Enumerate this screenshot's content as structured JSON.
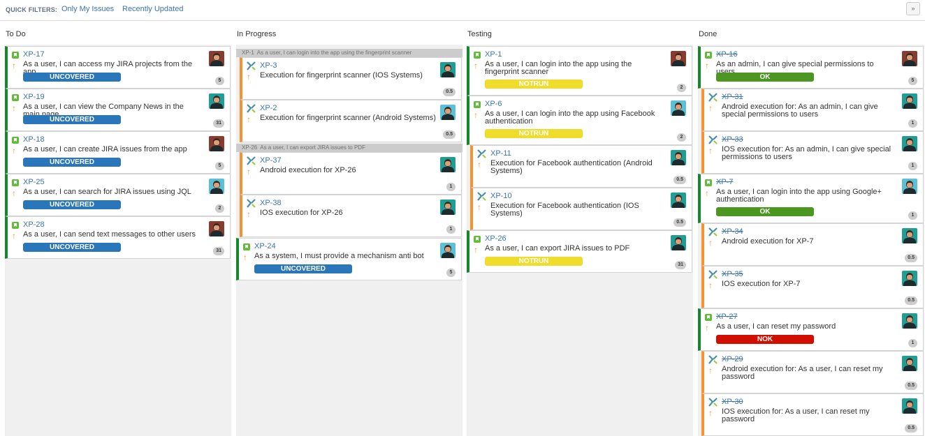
{
  "quick_filters": {
    "label": "QUICK FILTERS:",
    "links": [
      "Only My Issues",
      "Recently Updated"
    ],
    "toggle_glyph": "»"
  },
  "columns": [
    {
      "title": "To Do"
    },
    {
      "title": "In Progress"
    },
    {
      "title": "Testing"
    },
    {
      "title": "Done"
    }
  ],
  "swimlanes": [
    {
      "key": "XP-1",
      "summary": "As a user, I can login into the app using the fingerprint scanner"
    },
    {
      "key": "XP-26",
      "summary": "As a user, I can export JIRA issues to PDF"
    }
  ],
  "cards": {
    "todo": [
      {
        "key": "XP-17",
        "type": "story",
        "summary": "As a user, I can access my JIRA projects from the app",
        "status": "UNCOVERED",
        "estimate": "5",
        "avatar": "red"
      },
      {
        "key": "XP-19",
        "type": "story",
        "summary": "As a user, I can view the Company News in the main page",
        "status": "UNCOVERED",
        "estimate": "31",
        "avatar": "teal"
      },
      {
        "key": "XP-18",
        "type": "story",
        "summary": "As a user, I can create JIRA issues from the app",
        "status": "UNCOVERED",
        "estimate": "5",
        "avatar": "red"
      },
      {
        "key": "XP-25",
        "type": "story",
        "summary": "As a user, I can search for JIRA issues using JQL",
        "status": "UNCOVERED",
        "estimate": "2",
        "avatar": "blue"
      },
      {
        "key": "XP-28",
        "type": "story",
        "summary": "As a user, I can send text messages to other users",
        "status": "UNCOVERED",
        "estimate": "31",
        "avatar": "red"
      }
    ],
    "in_progress": [
      {
        "key": "XP-3",
        "type": "test",
        "summary": "Execution for fingerprint scanner (IOS Systems)",
        "status": "",
        "estimate": "0.5",
        "avatar": "teal"
      },
      {
        "key": "XP-2",
        "type": "test",
        "summary": "Execution for fingerprint scanner (Android Systems)",
        "status": "",
        "estimate": "0.5",
        "avatar": "blue"
      },
      {
        "key": "XP-37",
        "type": "test",
        "summary": "Android execution for XP-26",
        "status": "",
        "estimate": "1",
        "avatar": "teal"
      },
      {
        "key": "XP-38",
        "type": "test",
        "summary": "IOS execution for XP-26",
        "status": "",
        "estimate": "1",
        "avatar": "teal"
      },
      {
        "key": "XP-24",
        "type": "story",
        "summary": "As a system, I must provide a mechanism anti bot",
        "status": "UNCOVERED",
        "estimate": "5",
        "avatar": "blue"
      }
    ],
    "testing": [
      {
        "key": "XP-1",
        "type": "story",
        "summary": "As a user, I can login into the app using the fingerprint scanner",
        "status": "NOTRUN",
        "estimate": "2",
        "avatar": "red"
      },
      {
        "key": "XP-6",
        "type": "story",
        "summary": "As a user, I can login into the app using Facebook authentication",
        "status": "NOTRUN",
        "estimate": "2",
        "avatar": "blue"
      },
      {
        "key": "XP-11",
        "type": "test",
        "summary": "Execution for Facebook authentication (Android Systems)",
        "status": "",
        "estimate": "0.5",
        "avatar": "teal"
      },
      {
        "key": "XP-10",
        "type": "test",
        "summary": "Execution for Facebook authentication (IOS Systems)",
        "status": "",
        "estimate": "0.5",
        "avatar": "teal"
      },
      {
        "key": "XP-26",
        "type": "story",
        "summary": "As a user, I can export JIRA issues to PDF",
        "status": "NOTRUN",
        "estimate": "31",
        "avatar": "teal"
      }
    ],
    "done": [
      {
        "key": "XP-16",
        "type": "story",
        "summary": "As an admin, I can give special permissions to users",
        "status": "OK",
        "estimate": "5",
        "avatar": "red"
      },
      {
        "key": "XP-31",
        "type": "test",
        "summary": "Android execution for: As an admin, I can give special permissions to users",
        "status": "",
        "estimate": "1",
        "avatar": "teal"
      },
      {
        "key": "XP-33",
        "type": "test",
        "summary": "IOS execution for: As an admin, I can give special permissions to users",
        "status": "",
        "estimate": "1",
        "avatar": "teal"
      },
      {
        "key": "XP-7",
        "type": "story",
        "summary": "As a user, I can login into the app using Google+ authentication",
        "status": "OK",
        "estimate": "1",
        "avatar": "blue"
      },
      {
        "key": "XP-34",
        "type": "test",
        "summary": "Android execution for XP-7",
        "status": "",
        "estimate": "0.5",
        "avatar": "teal"
      },
      {
        "key": "XP-35",
        "type": "test",
        "summary": "IOS execution for XP-7",
        "status": "",
        "estimate": "0.5",
        "avatar": "teal"
      },
      {
        "key": "XP-27",
        "type": "story",
        "summary": "As a user, I can reset my password",
        "status": "NOK",
        "estimate": "1",
        "avatar": "teal"
      },
      {
        "key": "XP-29",
        "type": "test",
        "summary": "Android execution for: As a user, I can reset my password",
        "status": "",
        "estimate": "0.5",
        "avatar": "teal"
      },
      {
        "key": "XP-30",
        "type": "test",
        "summary": "IOS execution for: As a user, I can reset my password",
        "status": "",
        "estimate": "0.5",
        "avatar": "teal"
      }
    ]
  },
  "colors": {
    "story_border": "#14892c",
    "subtask_border": "#f79232",
    "uncovered": "#2a76bb",
    "notrun": "#f0dc2a",
    "ok": "#4c9722",
    "nok": "#d00f00"
  }
}
